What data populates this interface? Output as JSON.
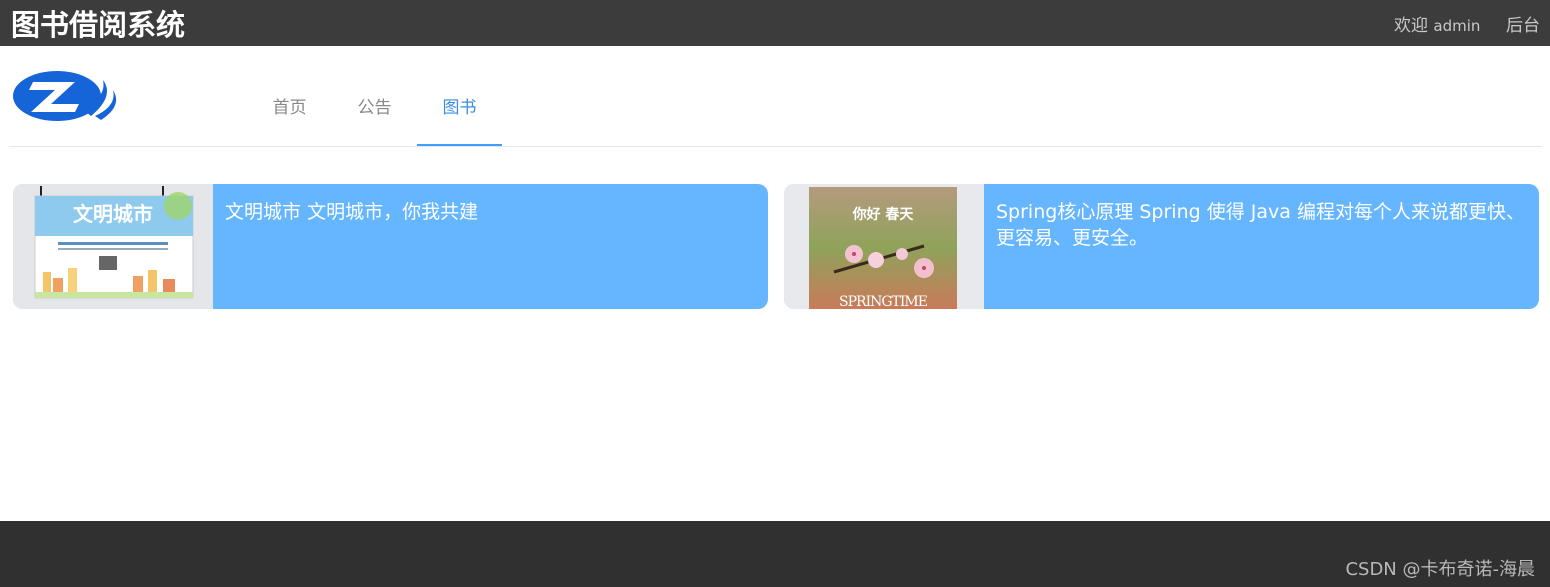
{
  "header": {
    "title": "图书借阅系统",
    "welcome_prefix": "欢迎",
    "username": "admin",
    "admin_link": "后台"
  },
  "nav": {
    "items": [
      "首页",
      "公告",
      "图书"
    ],
    "active_index": 2
  },
  "books": [
    {
      "title": "文明城市",
      "description": "文明城市，你我共建",
      "poster_text": "文明城市"
    },
    {
      "title": "Spring核心原理",
      "description": "Spring 使得 Java 编程对每个人来说都更快、更容易、更安全。",
      "poster_text": "你好 春天",
      "poster_caption": "SPRINGTIME"
    }
  ],
  "footer": {
    "text": "CSDN @卡布奇诺-海晨"
  },
  "colors": {
    "header_bg": "#3c3c3c",
    "card_bg": "#66b6ff",
    "nav_active": "#409eff",
    "footer_bg": "#303030"
  }
}
